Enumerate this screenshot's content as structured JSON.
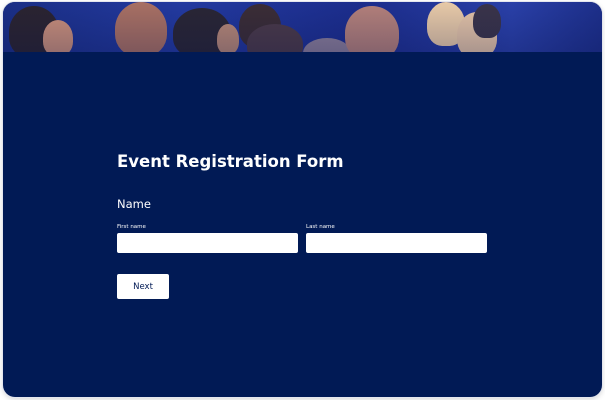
{
  "banner": {
    "image_description": "audience-photo"
  },
  "form": {
    "title": "Event Registration Form",
    "section_title": "Name",
    "first_name": {
      "label": "First name",
      "value": "",
      "placeholder": ""
    },
    "last_name": {
      "label": "Last name",
      "value": "",
      "placeholder": ""
    },
    "next_label": "Next"
  },
  "colors": {
    "background": "#011a55",
    "text": "#ffffff",
    "input_background": "#ffffff",
    "button_text": "#011a55"
  }
}
